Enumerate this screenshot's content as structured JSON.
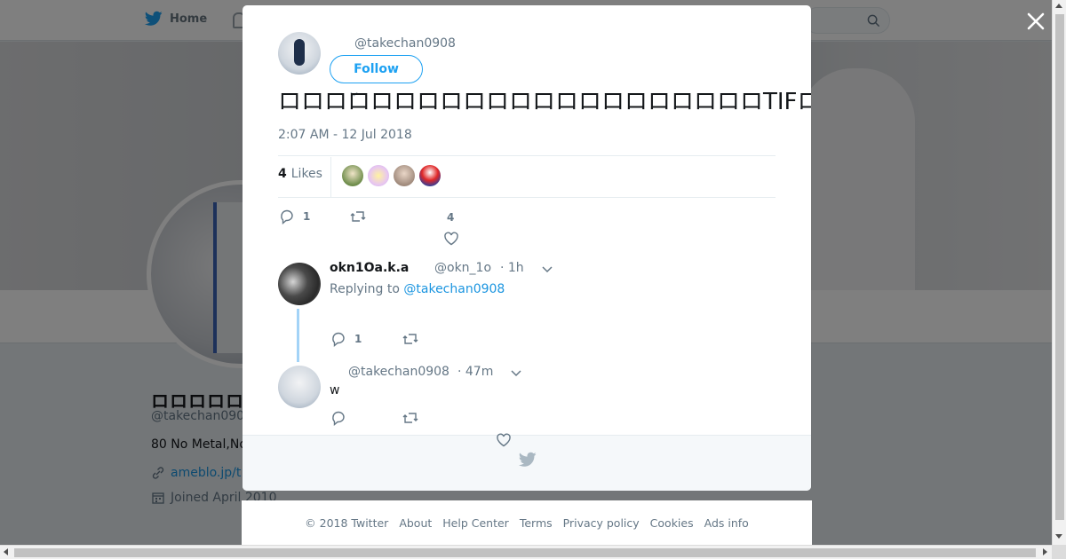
{
  "nav": {
    "home_label": "Home"
  },
  "profile": {
    "name": "ロロロロロロロロロロ",
    "handle": "@takechan090",
    "bio": "80 No Metal,No",
    "url": "ameblo.jp/t",
    "joined": "Joined April 2010"
  },
  "tweet": {
    "handle": "@takechan0908",
    "follow_label": "Follow",
    "text": "ロロロロロロロロロロロロロロロロロロロロロTIFロロロロロロロロロロロロロロロロロロロロロロロロw",
    "time": "2:07 AM - 12 Jul 2018",
    "likes_count": "4",
    "likes_label": "Likes",
    "reply_count": "1",
    "like_count": "4"
  },
  "replies": [
    {
      "name": "okn1Oa.k.a",
      "handle": "@okn_1o",
      "time": "· 1h",
      "replying_prefix": "Replying to",
      "replying_to": "@takechan0908",
      "reply_count": "1"
    },
    {
      "handle": "@takechan0908",
      "time": "· 47m",
      "text": "w"
    }
  ],
  "footer": {
    "copyright": "© 2018 Twitter",
    "about": "About",
    "help": "Help Center",
    "terms": "Terms",
    "privacy": "Privacy policy",
    "cookies": "Cookies",
    "ads": "Ads info"
  },
  "colors": {
    "accent": "#1da1f2",
    "link": "#1b95e0",
    "muted": "#657786"
  },
  "icons": [
    "twitter-bird-icon",
    "search-icon",
    "close-icon",
    "reply-icon",
    "retweet-icon",
    "heart-icon",
    "chevron-down-icon",
    "link-icon",
    "calendar-icon"
  ]
}
